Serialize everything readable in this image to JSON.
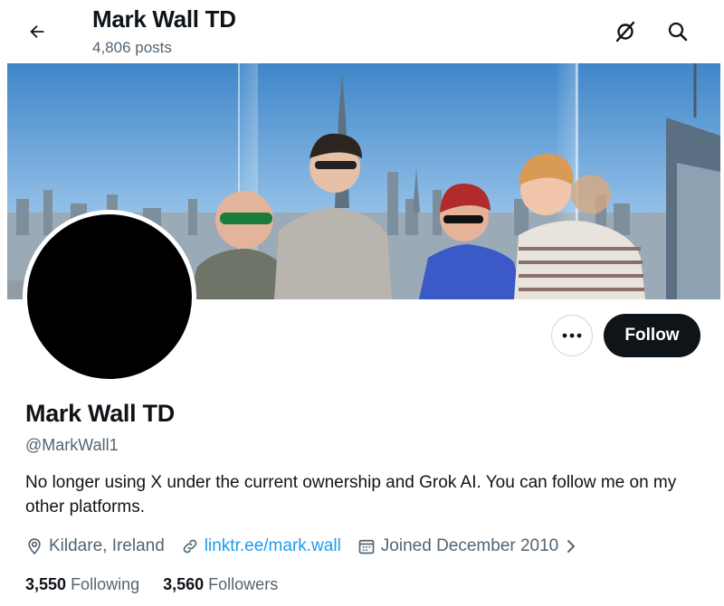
{
  "header": {
    "title": "Mark Wall TD",
    "posts_count": "4,806 posts",
    "back_icon": "arrow-left-icon",
    "grok_icon": "grok-icon",
    "search_icon": "search-icon"
  },
  "banner": {
    "kind": "photo of a family on an observation deck above the New York skyline"
  },
  "profile": {
    "display_name": "Mark Wall TD",
    "handle": "@MarkWall1",
    "bio": "No longer using X under the current ownership and Grok AI. You can follow me on my other platforms.",
    "location": "Kildare, Ireland",
    "website": "linktr.ee/mark.wall",
    "joined": "Joined December 2010"
  },
  "actions": {
    "more_icon": "more-dots-icon",
    "follow_label": "Follow"
  },
  "stats": {
    "following_count": "3,550",
    "following_label": "Following",
    "followers_count": "3,560",
    "followers_label": "Followers"
  },
  "colors": {
    "text": "#0f1419",
    "secondary": "#536471",
    "link": "#1d9bf0",
    "border": "#cfd9de"
  }
}
